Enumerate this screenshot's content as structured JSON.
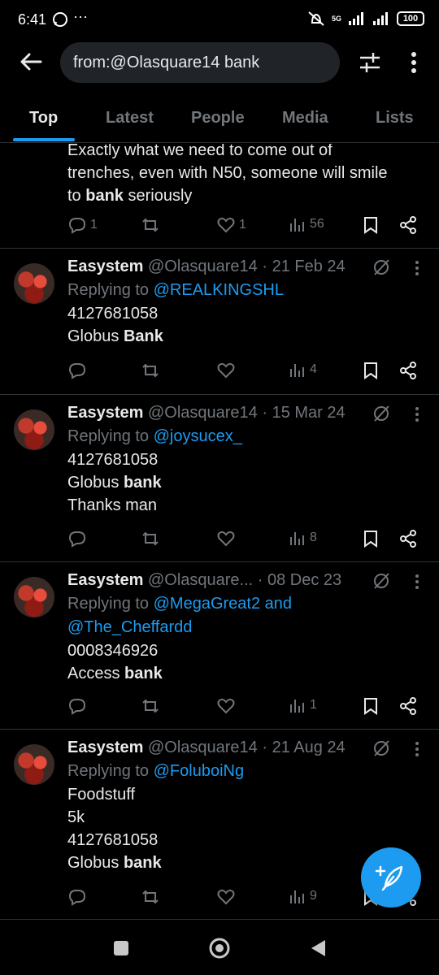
{
  "status_bar": {
    "time": "6:41",
    "battery": "100",
    "network": "5G"
  },
  "search": {
    "query": "from:@Olasquare14 bank"
  },
  "tabs": [
    {
      "label": "Top",
      "active": true
    },
    {
      "label": "Latest",
      "active": false
    },
    {
      "label": "People",
      "active": false
    },
    {
      "label": "Media",
      "active": false
    },
    {
      "label": "Lists",
      "active": false
    }
  ],
  "partial_tweet": {
    "lines": [
      "Exactly what we need to come out of",
      "trenches, even with N50, someone will smile",
      "to "
    ],
    "bold_word": "bank",
    "tail": " seriously",
    "replies": "1",
    "likes": "1",
    "views": "56"
  },
  "tweets": [
    {
      "name": "Easystem",
      "handle": "@Olasquare14",
      "date": "· 21 Feb 24",
      "replying_prefix": "Replying to ",
      "replying_to": "@REALKINGSHL",
      "replying_to2": "",
      "lines": [
        {
          "text": "4127681058",
          "bold": ""
        },
        {
          "text": "Globus ",
          "bold": "Bank"
        }
      ],
      "views": "4"
    },
    {
      "name": "Easystem",
      "handle": "@Olasquare14",
      "date": "· 15 Mar 24",
      "replying_prefix": "Replying to ",
      "replying_to": "@joysucex_",
      "replying_to2": "",
      "lines": [
        {
          "text": "4127681058",
          "bold": ""
        },
        {
          "text": "Globus ",
          "bold": "bank"
        },
        {
          "text": "Thanks man",
          "bold": ""
        }
      ],
      "views": "8"
    },
    {
      "name": "Easystem",
      "handle": "@Olasquare...",
      "date": "· 08 Dec 23",
      "replying_prefix": "Replying to ",
      "replying_to": "@MegaGreat2 and",
      "replying_to2": "@The_Cheffardd",
      "lines": [
        {
          "text": "0008346926",
          "bold": ""
        },
        {
          "text": "Access ",
          "bold": "bank"
        }
      ],
      "views": "1"
    },
    {
      "name": "Easystem",
      "handle": "@Olasquare14",
      "date": "· 21 Aug 24",
      "replying_prefix": "Replying to ",
      "replying_to": "@FoluboiNg",
      "replying_to2": "",
      "lines": [
        {
          "text": "Foodstuff",
          "bold": ""
        },
        {
          "text": "5k",
          "bold": ""
        },
        {
          "text": "4127681058",
          "bold": ""
        },
        {
          "text": "Globus ",
          "bold": "bank"
        }
      ],
      "views": "9"
    }
  ],
  "icons": {
    "back": "arrow-left-icon",
    "filter": "sliders-icon",
    "more": "more-vertical-icon",
    "reply": "reply-icon",
    "retweet": "retweet-icon",
    "like": "heart-icon",
    "views": "views-icon",
    "bookmark": "bookmark-icon",
    "share": "share-icon",
    "translate": "translate-off-icon",
    "compose": "compose-icon"
  },
  "colors": {
    "accent": "#1d9bf0",
    "text": "#e7e9ea",
    "muted": "#71767b",
    "divider": "#2f3336"
  }
}
